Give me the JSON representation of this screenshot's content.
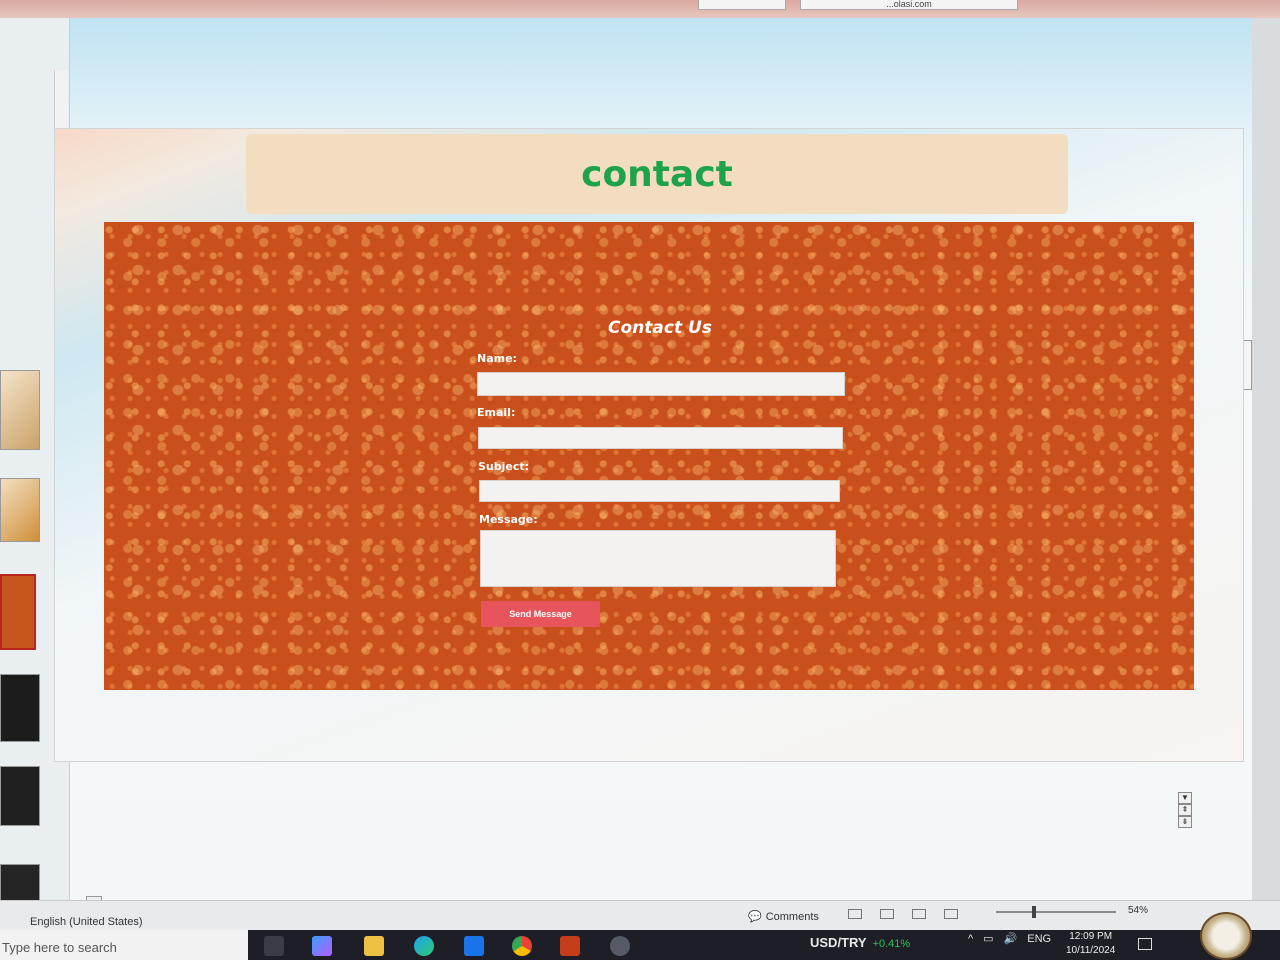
{
  "top_tabs": [
    "",
    "...olasi.com"
  ],
  "slide": {
    "title": "contact",
    "form": {
      "heading": "Contact Us",
      "fields": [
        {
          "label": "Name:",
          "value": ""
        },
        {
          "label": "Email:",
          "value": ""
        },
        {
          "label": "Subject:",
          "value": ""
        },
        {
          "label": "Message:",
          "value": ""
        }
      ],
      "submit_label": "Send Message"
    }
  },
  "status_bar": {
    "language": "English (United States)",
    "comments_label": "Comments",
    "zoom": "54%"
  },
  "taskbar": {
    "search_placeholder": "Type here to search",
    "ticker": "USD/TRY",
    "ticker_change": "+0.41%",
    "lang": "ENG",
    "time": "12:09 PM",
    "date": "10/11/2024"
  },
  "colors": {
    "title": "#1ea34a",
    "title_bg": "#f3ddc0",
    "panel": "#c9501c",
    "button": "#e8545c"
  },
  "icons": [
    "comments-icon",
    "normal-view-icon",
    "slide-sorter-icon",
    "reading-view-icon",
    "slideshow-icon",
    "task-view-icon",
    "copilot-icon",
    "file-explorer-icon",
    "edge-icon",
    "mail-icon",
    "chrome-icon",
    "powerpoint-icon",
    "settings-icon",
    "notification-icon"
  ]
}
